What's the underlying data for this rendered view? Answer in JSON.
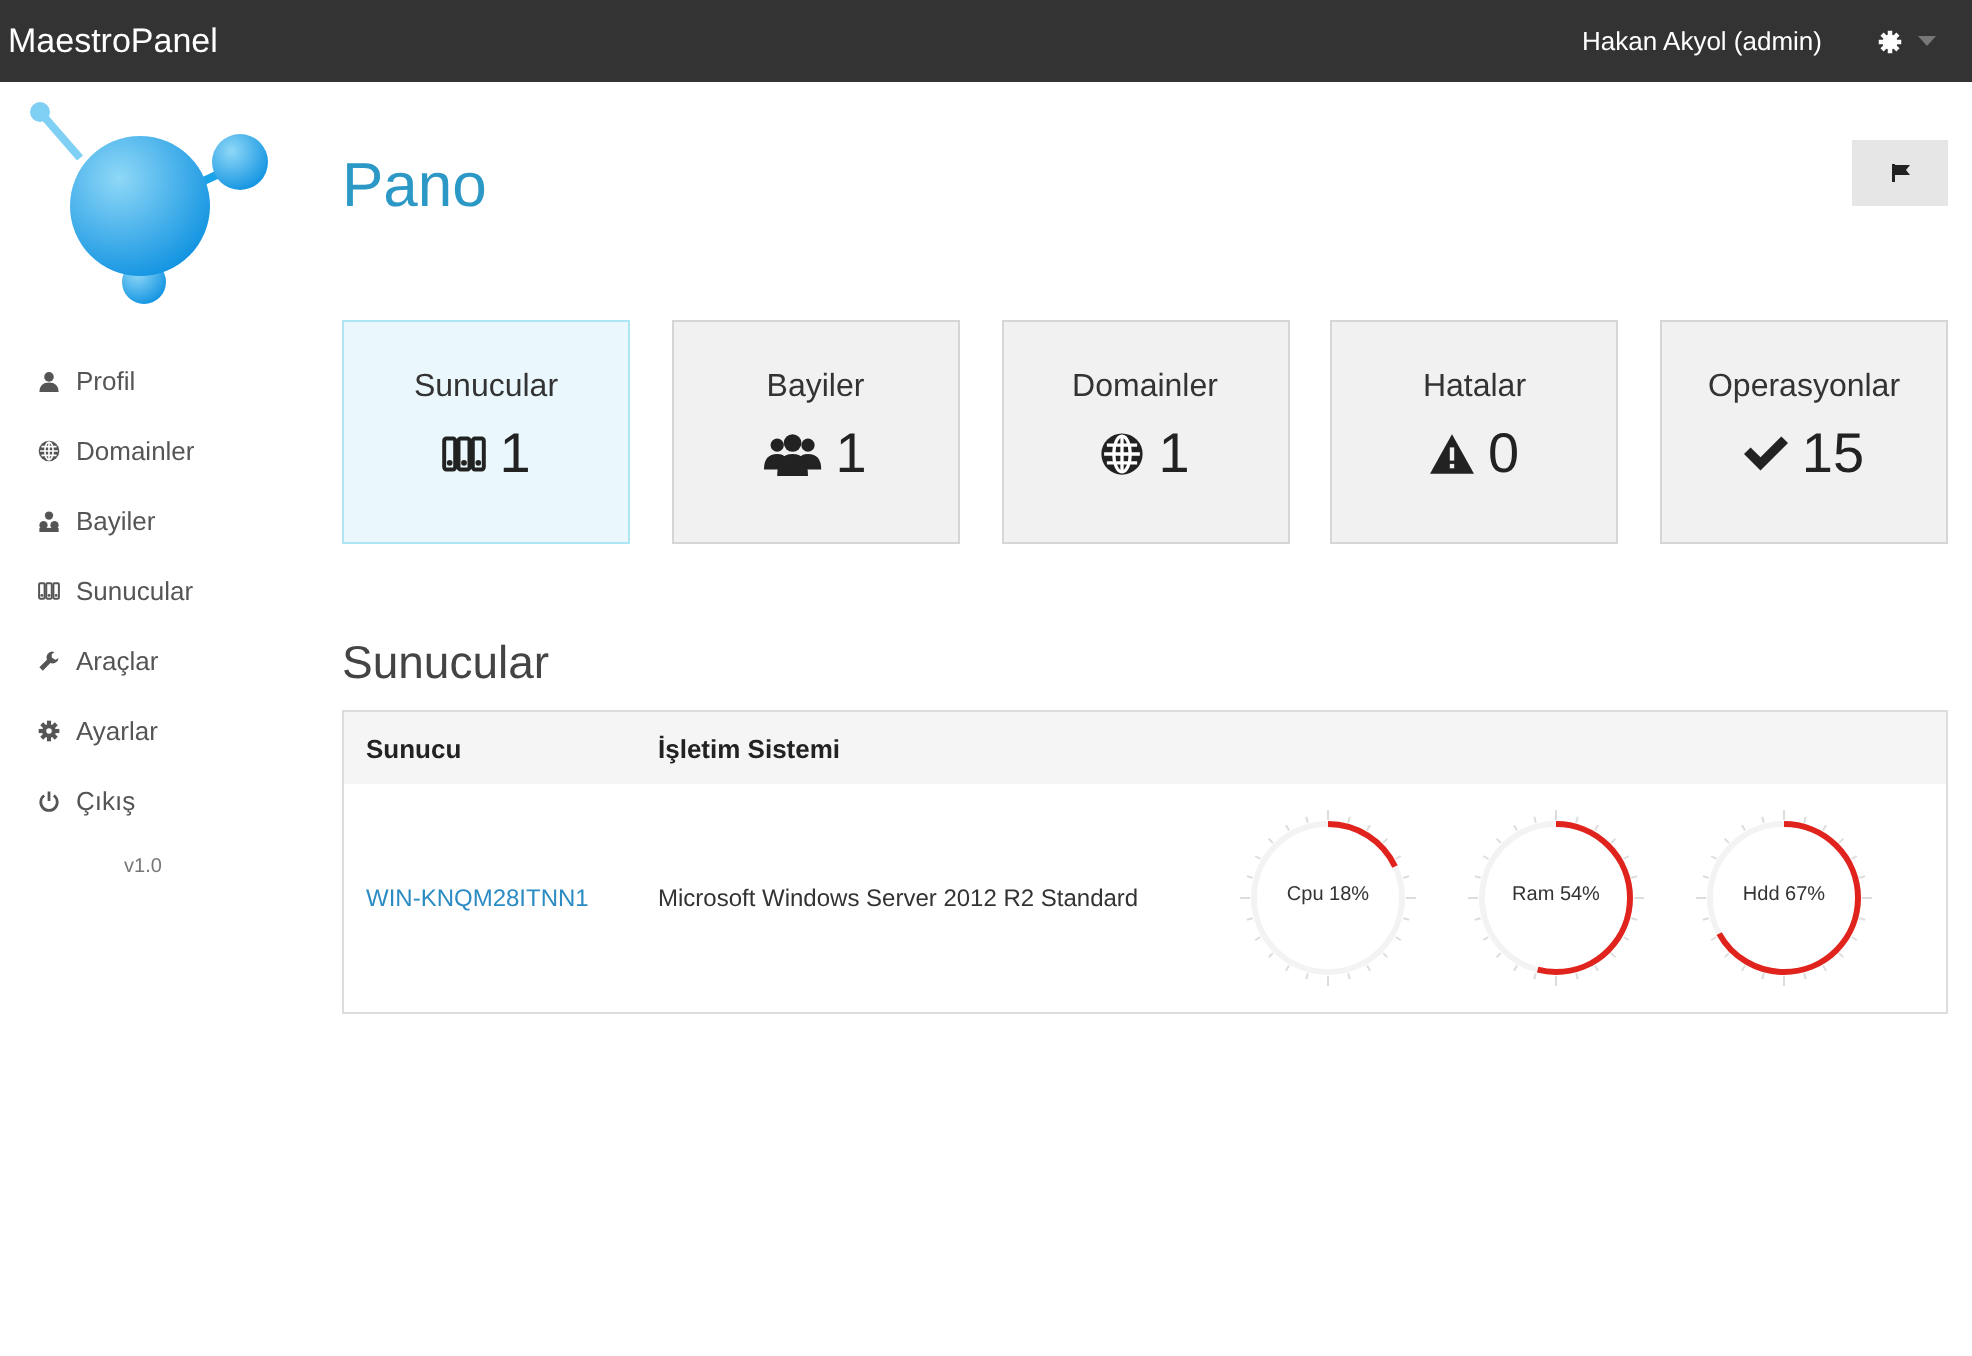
{
  "navbar": {
    "brand": "MaestroPanel",
    "user": "Hakan Akyol (admin)"
  },
  "sidebar": {
    "items": [
      {
        "label": "Profil",
        "kind": "user"
      },
      {
        "label": "Domainler",
        "kind": "globe"
      },
      {
        "label": "Bayiler",
        "kind": "sitemap"
      },
      {
        "label": "Sunucular",
        "kind": "servers"
      },
      {
        "label": "Araçlar",
        "kind": "wrench"
      },
      {
        "label": "Ayarlar",
        "kind": "gear"
      },
      {
        "label": "Çıkış",
        "kind": "power"
      }
    ],
    "version": "v1.0"
  },
  "page": {
    "title": "Pano"
  },
  "cards": [
    {
      "label": "Sunucular",
      "kind": "servers",
      "count": "1",
      "selected": true
    },
    {
      "label": "Bayiler",
      "kind": "users",
      "count": "1",
      "selected": false
    },
    {
      "label": "Domainler",
      "kind": "globe",
      "count": "1",
      "selected": false
    },
    {
      "label": "Hatalar",
      "kind": "warning",
      "count": "0",
      "selected": false
    },
    {
      "label": "Operasyonlar",
      "kind": "check",
      "count": "15",
      "selected": false
    }
  ],
  "servers": {
    "title": "Sunucular",
    "columns": [
      "Sunucu",
      "İşletim Sistemi"
    ],
    "rows": [
      {
        "name": "WIN-KNQM28ITNN1",
        "os": "Microsoft Windows Server 2012 R2 Standard",
        "gauges": [
          {
            "label": "Cpu 18%",
            "level": 0.18
          },
          {
            "label": "Ram 54%",
            "level": 0.54
          },
          {
            "label": "Hdd 67%",
            "level": 0.67
          }
        ]
      }
    ]
  }
}
